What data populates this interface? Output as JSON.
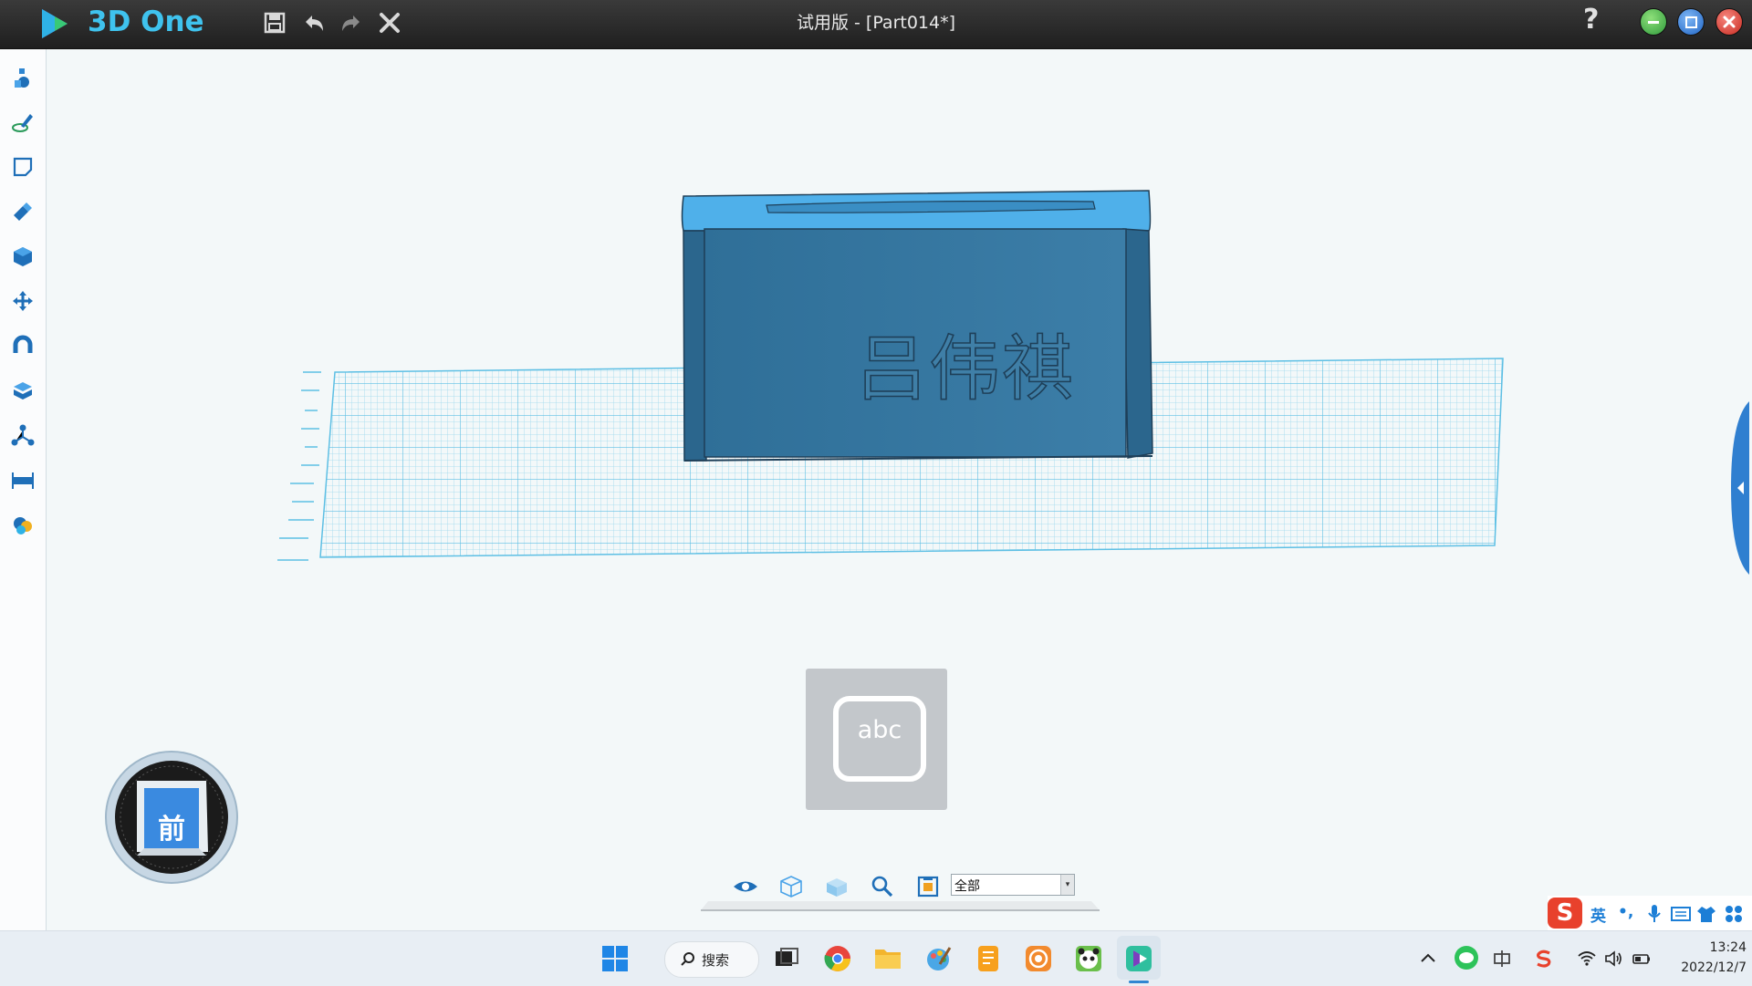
{
  "app": {
    "name": "3D One",
    "document_title": "试用版 - [Part014*]",
    "accent": "#3fc3ee"
  },
  "title_toolbar": {
    "icons": [
      "save-icon",
      "undo-icon",
      "redo-icon",
      "close-icon"
    ]
  },
  "window_controls": {
    "help": "?",
    "colors": {
      "minimize": "#3aa64a",
      "restore": "#2a7bd6",
      "close": "#d63a2f"
    }
  },
  "sidebar": {
    "tools": [
      "basic-solids-icon",
      "sketch-icon",
      "sketch-edit-icon",
      "feature-icon",
      "special-function-icon",
      "basic-edit-icon",
      "magnet-icon",
      "combine-icon",
      "array-icon",
      "measure-icon",
      "material-icon"
    ]
  },
  "model": {
    "engraved_text": "吕伟祺",
    "body_color": "#3f7fa7",
    "top_color": "#5cb8f0"
  },
  "viewcube": {
    "face_label": "前"
  },
  "text_tool": {
    "label": "abc"
  },
  "view_toolbar": {
    "icons": [
      "eye-icon",
      "wireframe-cube-icon",
      "shaded-cube-icon",
      "zoom-icon",
      "render-mode-icon"
    ],
    "filter": {
      "value": "全部"
    }
  },
  "ime": {
    "logo": "S",
    "mode": "英",
    "punct": "•,",
    "icons": [
      "mic-icon",
      "keyboard-icon",
      "skin-icon",
      "apps-grid-icon"
    ]
  },
  "taskbar": {
    "search_label": "搜索",
    "apps": [
      "start-icon",
      "taskview-icon",
      "chrome-icon",
      "explorer-icon",
      "paint-icon",
      "notes-icon",
      "codemao-icon",
      "panda-app-icon",
      "3d-one-taskbar-icon"
    ],
    "tray": [
      "chevron-up-icon",
      "wechat-icon",
      "ime-zh-icon",
      "sogou-icon",
      "wifi-icon",
      "volume-icon",
      "battery-icon"
    ],
    "time": "13:24",
    "date": "2022/12/7"
  }
}
